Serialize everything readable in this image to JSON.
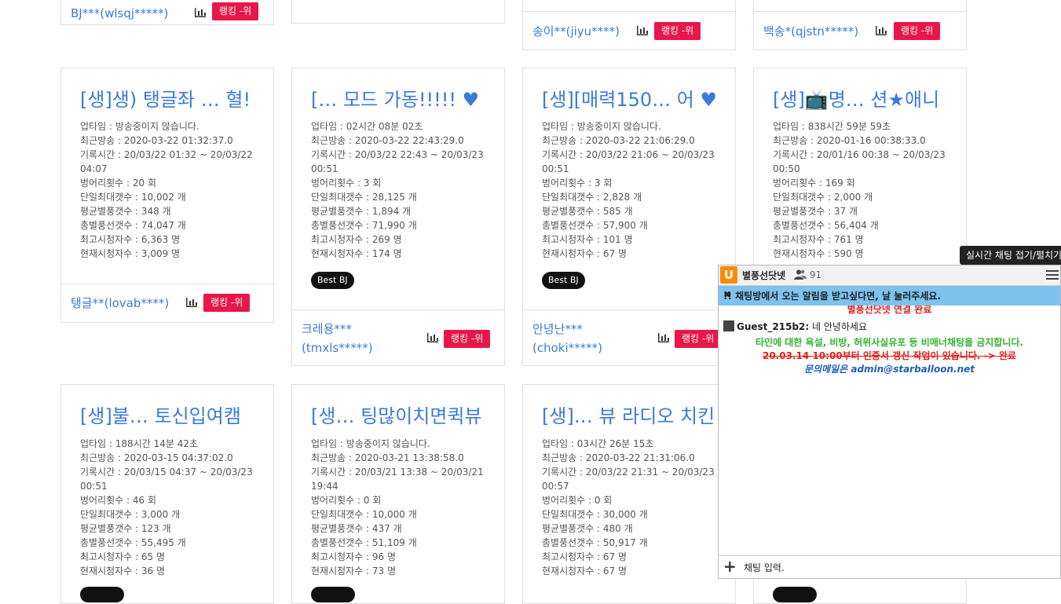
{
  "top_row": [
    {
      "name": "BJ***(wlsqj*****)",
      "rank": "랭킹 -위"
    },
    {
      "name": "",
      "rank": ""
    },
    {
      "name": "송이**(jiyu****)",
      "rank": "랭킹 -위"
    },
    {
      "name": "백송*(qjstn*****)",
      "rank": "랭킹 -위"
    }
  ],
  "cards": [
    {
      "title": "[생]생) 탱글좌 … 혈!",
      "stats": [
        "업타임 : 방송중이지 않습니다.",
        "최근방송 : 2020-03-22 01:32:37.0",
        "기록시간 : 20/03/22 01:32 ~ 20/03/22 04:07",
        "벙어리횟수 : 20 회",
        "단일최대갯수 : 10,002 개",
        "평균별풍갯수 : 348 개",
        "총별풍선갯수 : 74,047 개",
        "최고시청자수 : 6,363 명",
        "현재시청자수 : 3,009 명"
      ],
      "badge": "",
      "name": "탱글**(lovab****)",
      "rank": "랭킹 -위"
    },
    {
      "title": "[… 모드 가동!!!!! ♥",
      "stats": [
        "업타임 : 02시간 08분 02초",
        "최근방송 : 2020-03-22 22:43:29.0",
        "기록시간 : 20/03/22 22:43 ~ 20/03/23 00:51",
        "벙어리횟수 : 3 회",
        "단일최대갯수 : 28,125 개",
        "평균별풍갯수 : 1,894 개",
        "총별풍선갯수 : 71,990 개",
        "최고시청자수 : 269 명",
        "현재시청자수 : 174 명"
      ],
      "badge": "Best BJ",
      "name": "크레용***\n(tmxls*****)",
      "rank": "랭킹 -위"
    },
    {
      "title": "[생][매력150… 어 ♥",
      "stats": [
        "업타임 : 방송중이지 않습니다.",
        "최근방송 : 2020-03-22 21:06:29.0",
        "기록시간 : 20/03/22 21:06 ~ 20/03/23 00:51",
        "벙어리횟수 : 3 회",
        "단일최대갯수 : 2,828 개",
        "평균별풍갯수 : 585 개",
        "총별풍선갯수 : 57,900 개",
        "최고시청자수 : 101 명",
        "현재시청자수 : 67 명"
      ],
      "badge": "Best BJ",
      "name": "안녕난***\n(choki*****)",
      "rank": "랭킹 -위"
    },
    {
      "title": "[생]📺명… 션★애니",
      "stats": [
        "업타임 : 838시간 59분 59초",
        "최근방송 : 2020-01-16 00:38:33.0",
        "기록시간 : 20/01/16 00:38 ~ 20/03/23 00:50",
        "벙어리횟수 : 169 회",
        "단일최대갯수 : 2,000 개",
        "평균별풍갯수 : 37 개",
        "총별풍선갯수 : 56,404 개",
        "최고시청자수 : 761 명",
        "현재시청자수 : 590 명"
      ],
      "badge": "",
      "name": "",
      "rank": ""
    },
    {
      "title": "[생]불… 토신입여캠",
      "stats": [
        "업타임 : 188시간 14분 42초",
        "최근방송 : 2020-03-15 04:37:02.0",
        "기록시간 : 20/03/15 04:37 ~ 20/03/23 00:51",
        "벙어리횟수 : 46 회",
        "단일최대갯수 : 3,000 개",
        "평균별풍갯수 : 123 개",
        "총별풍선갯수 : 55,495 개",
        "최고시청자수 : 65 명",
        "현재시청자수 : 36 명"
      ],
      "badge": "",
      "name": "",
      "rank": ""
    },
    {
      "title": "[생… 팅많이치면퀵뷰",
      "stats": [
        "업타임 : 방송중이지 않습니다.",
        "최근방송 : 2020-03-21 13:38:58.0",
        "기록시간 : 20/03/21 13:38 ~ 20/03/21 19:44",
        "벙어리횟수 : 0 회",
        "단일최대갯수 : 10,000 개",
        "평균별풍갯수 : 437 개",
        "총별풍선갯수 : 51,109 개",
        "최고시청자수 : 96 명",
        "현재시청자수 : 73 명"
      ],
      "badge": "",
      "name": "",
      "rank": ""
    },
    {
      "title": "[생]… 뷰 라디오 치킨",
      "stats": [
        "업타임 : 03시간 26분 15초",
        "최근방송 : 2020-03-22 21:31:06.0",
        "기록시간 : 20/03/22 21:31 ~ 20/03/23 00:57",
        "벙어리횟수 : 0 회",
        "단일최대갯수 : 30,000 개",
        "평균별풍갯수 : 480 개",
        "총별풍선갯수 : 50,917 개",
        "최고시청자수 : 67 명",
        "현재시청자수 : 67 명"
      ],
      "badge": "",
      "name": "",
      "rank": ""
    }
  ],
  "chat": {
    "title": "별풍선닷넷",
    "user_count": "91",
    "notice": "!! 채팅방에서 오는 알림을 받고싶다면, 날 눌러주세요.",
    "connected": "별풍선닷넷 연결 완료",
    "message_user": "Guest_215b2:",
    "message_text": "네 안녕하세요",
    "warning": "타인에 대한 욕설, 비방, 허위사실유포 등 비매너채팅을 금지합니다.",
    "update": "20.03.14 10:00부터 인증서 갱신 작업이 있습니다. -> 완료",
    "contact": "문의메일은 admin@starballoon.net",
    "input_placeholder": "채팅 입력.",
    "tooltip": "실시간 채팅 접기/펼치기"
  }
}
